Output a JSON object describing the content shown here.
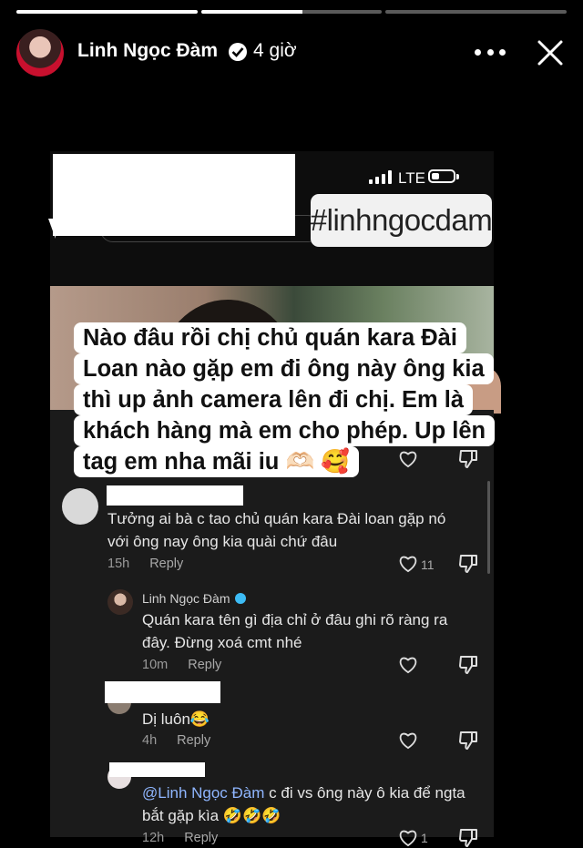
{
  "story": {
    "progress": [
      1,
      0.56,
      0
    ]
  },
  "header": {
    "user_name": "Linh Ngọc Đàm",
    "time_ago": "4 giờ"
  },
  "screenshot": {
    "network": "LTE",
    "hashtag": "#linhngocdam",
    "caption_lines": [
      "Nào đâu rồi chị chủ quán kara Đài",
      "Loan nào gặp em đi ông này ông kia",
      "thì up ảnh camera lên đi chị. Em là",
      "khách hàng mà em cho phép. Up lên",
      "tag em nha mãi iu 🫶🏻 🥰"
    ]
  },
  "comments": [
    {
      "text_lines": [
        "Tưởng ai bà c tao chủ quán kara Đài loan gặp nó",
        "với ông nay ông kia quài chứ đâu"
      ],
      "time": "15h",
      "reply": "Reply",
      "likes": "11"
    },
    {
      "author": "Linh Ngọc Đàm",
      "text_lines": [
        "Quán kara tên gì địa chỉ ở đâu ghi rõ ràng ra",
        "đây. Đừng xoá cmt nhé"
      ],
      "time": "10m",
      "reply": "Reply"
    },
    {
      "text": "Dị luôn😂",
      "time": "4h",
      "reply": "Reply"
    },
    {
      "mention": "@Linh Ngọc Đàm",
      "text_rest": " c đi vs ông này ô kia để ngta",
      "text_line2": "bắt gặp kìa 🤣🤣🤣",
      "time": "12h",
      "reply": "Reply",
      "likes": "1"
    }
  ]
}
